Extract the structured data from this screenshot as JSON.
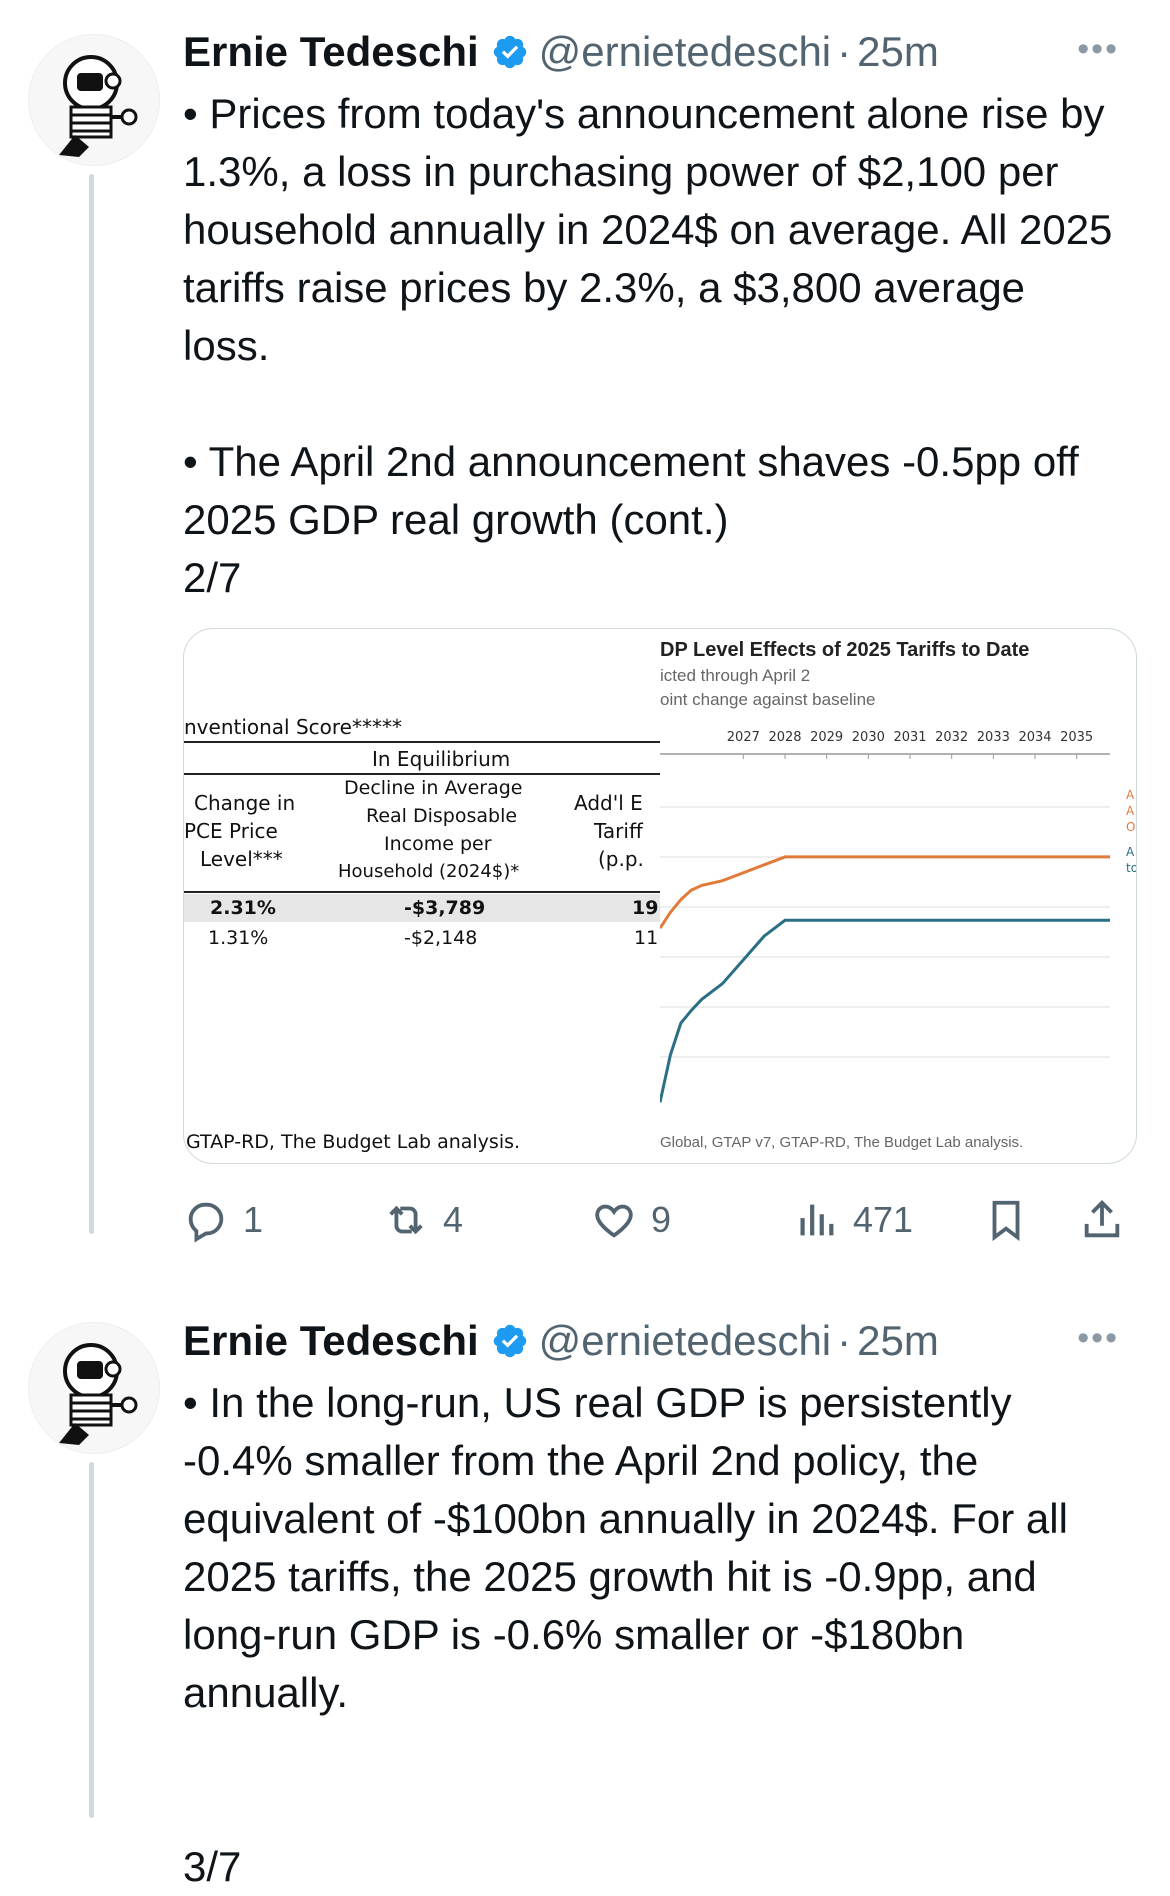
{
  "tweets": [
    {
      "author": {
        "name": "Ernie Tedeschi",
        "handle": "@ernietedeschi",
        "time": "25m",
        "verified": true
      },
      "text": "• Prices from today's announcement alone rise by 1.3%, a loss in purchasing power of $2,100 per household annually in 2024$ on average. All 2025 tariffs raise prices by 2.3%, a $3,800 average loss.\n\n• The April 2nd announcement shaves -0.5pp off 2025 GDP real growth (cont.)\n2/7",
      "media": {
        "table": {
          "section_title": "nventional Score*****",
          "group_header": "In Equilibrium",
          "col_pce": [
            "Change in",
            "PCE Price",
            "Level***"
          ],
          "col_decline": [
            "Decline in Average",
            "Real Disposable",
            "Income per",
            "Household (2024$)*"
          ],
          "col_addl": [
            "Add'l E",
            "Tariff",
            "(p.p."
          ],
          "rows": [
            {
              "pce": "2.31%",
              "decline": "-$3,789",
              "addl": "19"
            },
            {
              "pce": "1.31%",
              "decline": "-$2,148",
              "addl": "11"
            }
          ],
          "source": "GTAP-RD, The Budget Lab analysis."
        },
        "chart": {
          "title": "DP Level Effects of 2025 Tariffs to Date",
          "subtitle1": "icted through April 2",
          "subtitle2": "oint change against baseline",
          "source": "Global, GTAP v7, GTAP-RD, The Budget Lab analysis.",
          "right_labels_orange": [
            "A",
            "A",
            "O"
          ],
          "right_labels_teal": [
            "A",
            "to"
          ]
        }
      },
      "actions": {
        "replies": "1",
        "reposts": "4",
        "likes": "9",
        "views": "471"
      }
    },
    {
      "author": {
        "name": "Ernie Tedeschi",
        "handle": "@ernietedeschi",
        "time": "25m",
        "verified": true
      },
      "text": "• In the long-run, US real GDP is persistently -0.4% smaller from the April 2nd policy, the equivalent of -$100bn annually in 2024$. For all 2025 tariffs, the 2025 growth hit is -0.9pp, and long-run GDP is -0.6% smaller or -$180bn annually.\n\n\n3/7"
    }
  ],
  "chart_data": {
    "type": "line",
    "title": "DP Level Effects of 2025 Tariffs to Date",
    "x": [
      2025.0,
      2025.25,
      2025.5,
      2025.75,
      2026.0,
      2026.5,
      2027.0,
      2027.5,
      2028.0,
      2029.0,
      2030.0,
      2031.0,
      2032.0,
      2033.0,
      2034.0,
      2035.0,
      2035.8
    ],
    "x_ticks": [
      "2027",
      "2028",
      "2029",
      "2030",
      "2031",
      "2032",
      "2033",
      "2034",
      "2035"
    ],
    "series": [
      {
        "color": "#e07b39",
        "values": [
          -0.9,
          -0.8,
          -0.72,
          -0.66,
          -0.63,
          -0.6,
          -0.55,
          -0.5,
          -0.45,
          -0.45,
          -0.45,
          -0.45,
          -0.45,
          -0.45,
          -0.45,
          -0.45,
          -0.45
        ]
      },
      {
        "color": "#2a6f84",
        "values": [
          -2.0,
          -1.7,
          -1.5,
          -1.42,
          -1.35,
          -1.25,
          -1.1,
          -0.95,
          -0.85,
          -0.85,
          -0.85,
          -0.85,
          -0.85,
          -0.85,
          -0.85,
          -0.85,
          -0.85
        ]
      }
    ],
    "ylim": [
      -2.2,
      0.2
    ],
    "grid": true
  }
}
